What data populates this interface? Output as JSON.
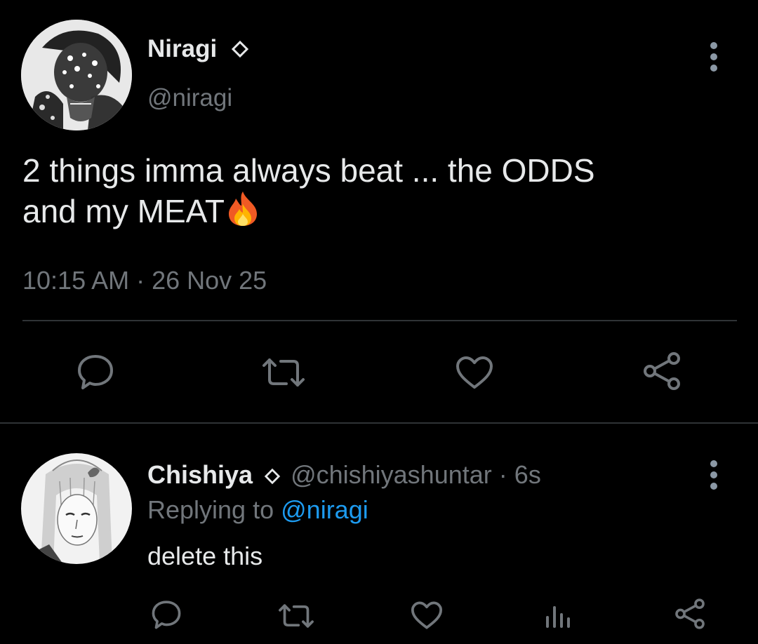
{
  "colors": {
    "background": "#000000",
    "text": "#e7e9ea",
    "secondary": "#71767b",
    "accent": "#1d9bf0",
    "divider": "#2f3336"
  },
  "main_tweet": {
    "display_name": "Niragi",
    "handle": "@niragi",
    "badge_icon": "diamond-outline-icon",
    "text_line1": "2 things imma always beat ... the ODDS",
    "text_line2": "and my MEAT",
    "emoji": "🔥",
    "emoji_icon": "fire-emoji-icon",
    "timestamp": "10:15 AM · 26 Nov 25",
    "actions": [
      "reply-icon",
      "retweet-icon",
      "like-icon",
      "share-icon"
    ]
  },
  "reply_tweet": {
    "display_name": "Chishiya",
    "badge_icon": "diamond-outline-icon",
    "handle": "@chishiyashuntar",
    "separator": "·",
    "time": "6s",
    "replying_prefix": "Replying to",
    "replying_handle": "@niragi",
    "text": "delete this",
    "actions": [
      "reply-icon",
      "retweet-icon",
      "like-icon",
      "analytics-icon",
      "share-icon"
    ]
  }
}
